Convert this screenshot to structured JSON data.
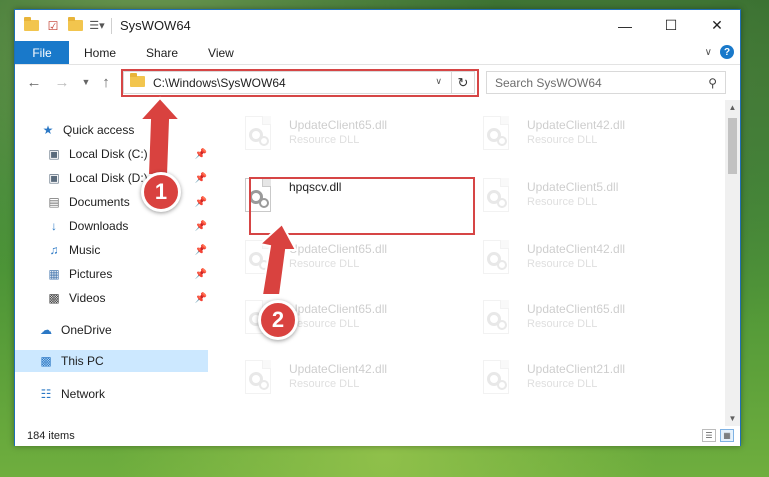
{
  "window": {
    "title": "SysWOW64",
    "controls": {
      "minimize": "—",
      "maximize": "☐",
      "close": "✕"
    }
  },
  "ribbon": {
    "tabs": [
      {
        "label": "File"
      },
      {
        "label": "Home"
      },
      {
        "label": "Share"
      },
      {
        "label": "View"
      }
    ],
    "help": "?"
  },
  "address": {
    "path": "C:\\Windows\\SysWOW64",
    "refresh_icon": "refresh-icon"
  },
  "search": {
    "placeholder": "Search SysWOW64"
  },
  "nav": {
    "quick_access": "Quick access",
    "items": [
      {
        "label": "Local Disk (C:)",
        "icon": "drive-icon",
        "pinned": true
      },
      {
        "label": "Local Disk (D:)",
        "icon": "drive-icon",
        "pinned": true
      },
      {
        "label": "Documents",
        "icon": "documents-icon",
        "pinned": true
      },
      {
        "label": "Downloads",
        "icon": "downloads-icon",
        "pinned": true
      },
      {
        "label": "Music",
        "icon": "music-icon",
        "pinned": true
      },
      {
        "label": "Pictures",
        "icon": "pictures-icon",
        "pinned": true
      },
      {
        "label": "Videos",
        "icon": "videos-icon",
        "pinned": true
      }
    ],
    "onedrive": "OneDrive",
    "this_pc": "This PC",
    "network": "Network"
  },
  "files": {
    "col1": [
      {
        "name": "UpdateClient65.dll",
        "type": "Resource DLL"
      },
      {
        "name": "hpqscv.dll",
        "type": ""
      },
      {
        "name": "UpdateClient65.dll",
        "type": "Resource DLL"
      },
      {
        "name": "UpdateClient65.dll",
        "type": "Resource DLL"
      },
      {
        "name": "UpdateClient42.dll",
        "type": "Resource DLL"
      }
    ],
    "col2": [
      {
        "name": "UpdateClient42.dll",
        "type": "Resource DLL"
      },
      {
        "name": "UpdateClient5.dll",
        "type": "Resource DLL"
      },
      {
        "name": "UpdateClient42.dll",
        "type": "Resource DLL"
      },
      {
        "name": "UpdateClient65.dll",
        "type": "Resource DLL"
      },
      {
        "name": "UpdateClient21.dll",
        "type": "Resource DLL"
      }
    ]
  },
  "status": {
    "items_count": "184 items"
  },
  "annotations": {
    "step1": "1",
    "step2": "2"
  },
  "colors": {
    "accent": "#1979ca",
    "highlight": "#d64545",
    "selected": "#cce8ff"
  }
}
